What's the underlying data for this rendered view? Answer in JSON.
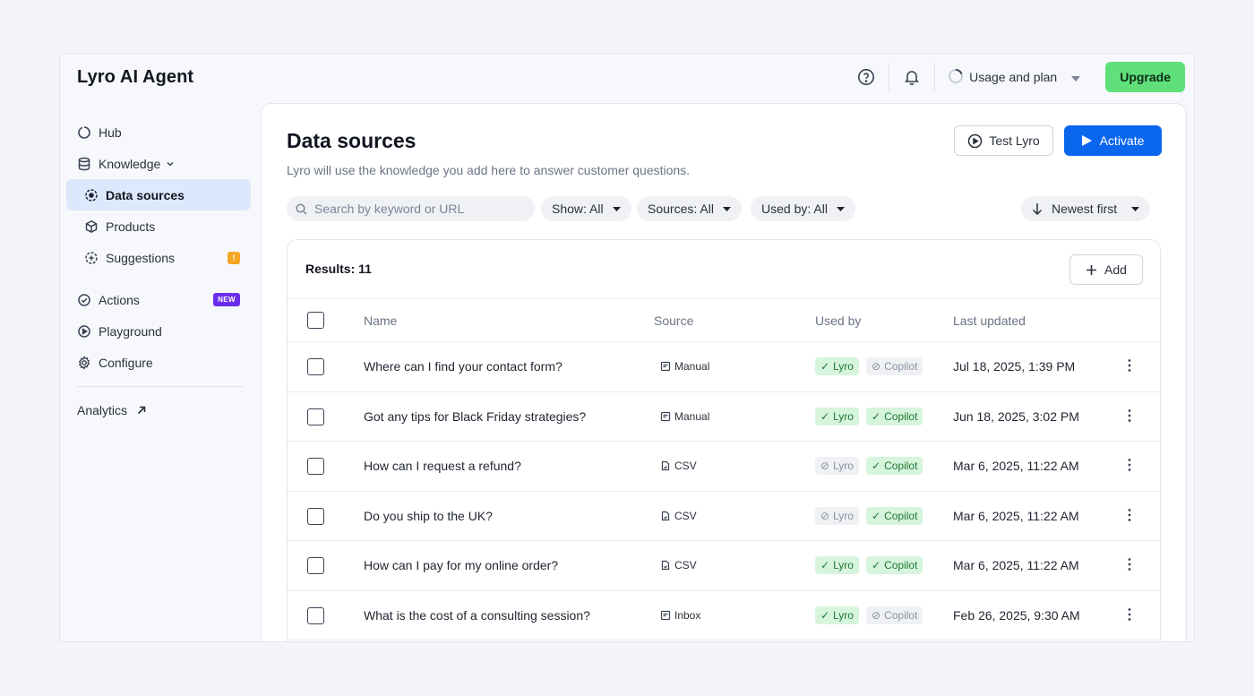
{
  "app": {
    "title": "Lyro AI Agent"
  },
  "topbar": {
    "help_icon": "help-circle-icon",
    "bell_icon": "bell-icon",
    "usage_label": "Usage and plan",
    "upgrade_label": "Upgrade"
  },
  "sidebar": {
    "hub": "Hub",
    "knowledge": "Knowledge",
    "data_sources": "Data sources",
    "products": "Products",
    "suggestions": "Suggestions",
    "suggestions_badge": "!",
    "actions": "Actions",
    "actions_badge": "NEW",
    "playground": "Playground",
    "configure": "Configure",
    "analytics": "Analytics"
  },
  "main": {
    "title": "Data sources",
    "subtitle": "Lyro will use the knowledge you add here to answer customer questions.",
    "test_label": "Test Lyro",
    "activate_label": "Activate",
    "search_placeholder": "Search by keyword or URL",
    "filters": {
      "show": "Show: All",
      "sources": "Sources: All",
      "used_by": "Used by: All",
      "sort": "Newest first"
    }
  },
  "table": {
    "results": "Results: 11",
    "add_label": "Add",
    "columns": {
      "name": "Name",
      "source": "Source",
      "used_by": "Used by",
      "updated": "Last updated"
    },
    "tag_labels": {
      "lyro": "Lyro",
      "copilot": "Copilot"
    },
    "rows": [
      {
        "name": "Where can I find your contact form?",
        "source": "Manual",
        "updated": "Jul 18, 2025, 1:39 PM"
      },
      {
        "name": "Got any tips for Black Friday strategies?",
        "source": "Manual",
        "updated": "Jun 18, 2025, 3:02 PM"
      },
      {
        "name": "How can I request a refund?",
        "source": "CSV",
        "updated": "Mar 6, 2025, 11:22 AM"
      },
      {
        "name": "Do you ship to the UK?",
        "source": "CSV",
        "updated": "Mar 6, 2025, 11:22 AM"
      },
      {
        "name": "How can I pay for my online order?",
        "source": "CSV",
        "updated": "Mar 6, 2025, 11:22 AM"
      },
      {
        "name": "What is the cost of a consulting session?",
        "source": "Inbox",
        "updated": "Feb 26, 2025, 9:30 AM"
      }
    ]
  },
  "colors": {
    "accent": "#0b66ee",
    "upgrade": "#5fe07a",
    "active_nav": "#dce8fb",
    "tag_on": "#d7f4dd",
    "new_badge": "#6a2ee8",
    "warn_badge": "#f5a623"
  }
}
